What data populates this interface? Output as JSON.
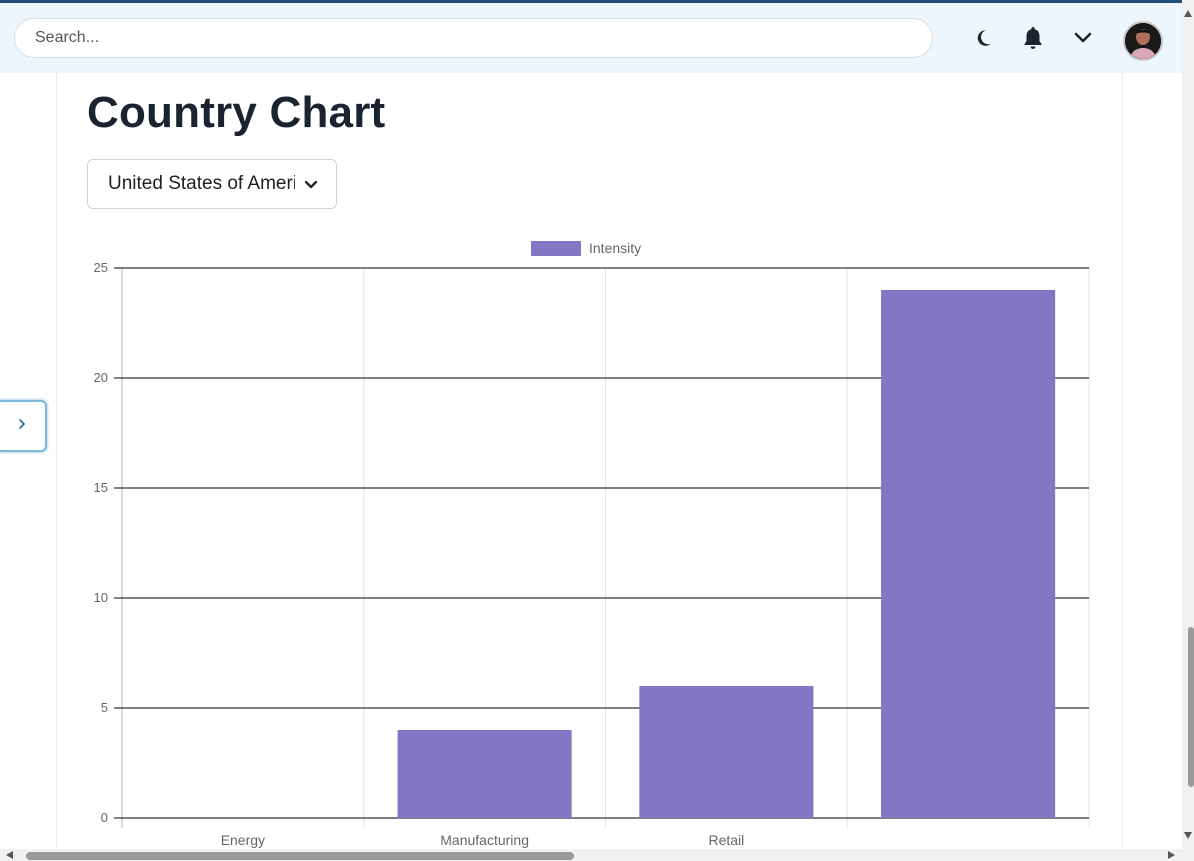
{
  "header": {
    "search_placeholder": "Search...",
    "icons": [
      "moon-icon",
      "bell-icon",
      "chevron-down-icon",
      "avatar"
    ]
  },
  "page": {
    "title": "Country Chart",
    "country_select_value": "United States of America"
  },
  "colors": {
    "bar": "#8476c4",
    "topbar": "#eef6fd",
    "title": "#1b2330"
  },
  "chart_data": {
    "type": "bar",
    "categories": [
      "Energy",
      "Manufacturing",
      "Retail",
      ""
    ],
    "series": [
      {
        "name": "Intensity",
        "values": [
          0,
          4,
          6,
          24
        ]
      }
    ],
    "ylim": [
      0,
      25
    ],
    "yticks": [
      0,
      5,
      10,
      15,
      20,
      25
    ],
    "legend": "top-center",
    "grid": true
  }
}
